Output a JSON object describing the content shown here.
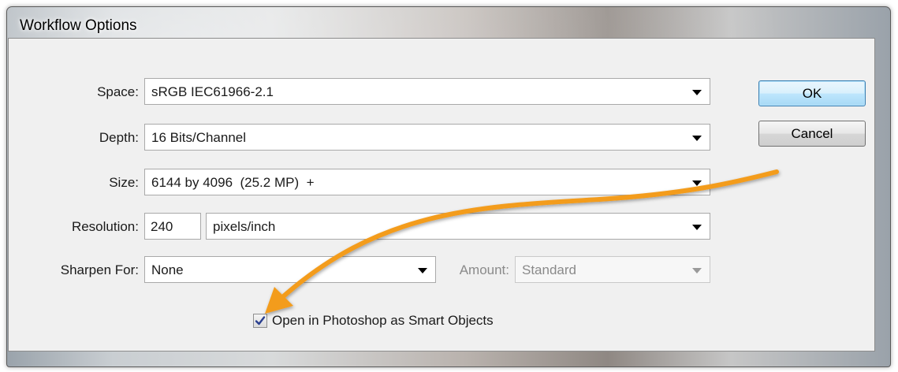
{
  "window": {
    "title": "Workflow Options"
  },
  "form": {
    "space": {
      "label": "Space:",
      "value": "sRGB IEC61966-2.1"
    },
    "depth": {
      "label": "Depth:",
      "value": "16 Bits/Channel"
    },
    "size": {
      "label": "Size:",
      "value": "6144 by 4096  (25.2 MP)  +"
    },
    "resolution": {
      "label": "Resolution:",
      "value": "240",
      "unit": "pixels/inch"
    },
    "sharpen": {
      "label": "Sharpen For:",
      "value": "None"
    },
    "amount": {
      "label": "Amount:",
      "value": "Standard"
    },
    "smart_objects": {
      "label": "Open in Photoshop as Smart Objects",
      "checked": true
    }
  },
  "buttons": {
    "ok": "OK",
    "cancel": "Cancel"
  },
  "colors": {
    "annotation_arrow": "#f39c1e",
    "default_button_border": "#3c7fb1"
  },
  "icons": [
    "checkmark-icon",
    "dropdown-arrow-icon",
    "annotation-arrow-icon"
  ]
}
